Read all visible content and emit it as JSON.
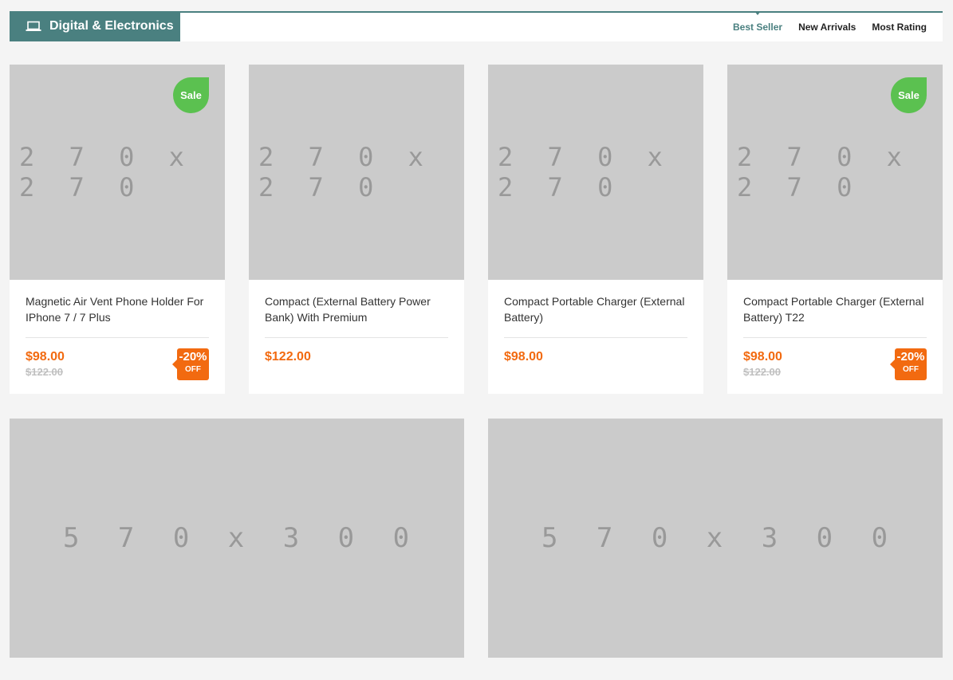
{
  "header": {
    "title": "Digital & Electronics",
    "icon": "laptop-icon",
    "accent_color": "#4a8080",
    "tabs": [
      {
        "label": "Best Seller",
        "active": true
      },
      {
        "label": "New Arrivals",
        "active": false
      },
      {
        "label": "Most Rating",
        "active": false
      }
    ]
  },
  "products": [
    {
      "image_placeholder": "2 7 0 x 2 7 0",
      "sale_badge": "Sale",
      "name": "Magnetic Air Vent Phone Holder For IPhone 7 / 7 Plus",
      "price": "$98.00",
      "old_price": "$122.00",
      "discount": {
        "percent": "-20%",
        "off": "OFF"
      }
    },
    {
      "image_placeholder": "2 7 0 x 2 7 0",
      "sale_badge": null,
      "name": "Compact (External Battery Power Bank) With Premium",
      "price": "$122.00",
      "old_price": null,
      "discount": null
    },
    {
      "image_placeholder": "2 7 0 x 2 7 0",
      "sale_badge": null,
      "name": "Compact Portable Charger (External Battery)",
      "price": "$98.00",
      "old_price": null,
      "discount": null
    },
    {
      "image_placeholder": "2 7 0 x 2 7 0",
      "sale_badge": "Sale",
      "name": "Compact Portable Charger (External Battery) T22",
      "price": "$98.00",
      "old_price": "$122.00",
      "discount": {
        "percent": "-20%",
        "off": "OFF"
      }
    }
  ],
  "banners": [
    {
      "image_placeholder": "5 7 0 x 3 0 0"
    },
    {
      "image_placeholder": "5 7 0 x 3 0 0"
    }
  ],
  "colors": {
    "price": "#f26a10",
    "sale_badge": "#5bc150",
    "placeholder_bg": "#cbcbcb"
  }
}
